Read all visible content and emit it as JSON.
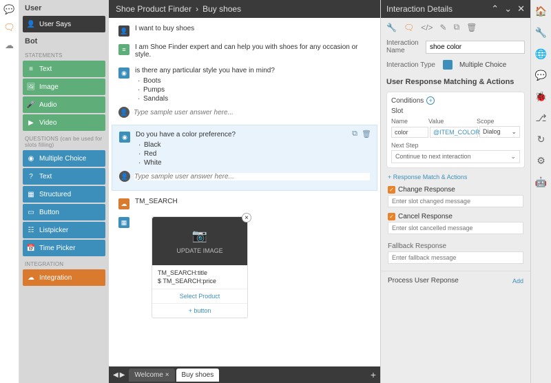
{
  "breadcrumb": {
    "project": "Shoe Product Finder",
    "flow": "Buy shoes"
  },
  "palette": {
    "user_header": "User",
    "user_says": "User Says",
    "bot_header": "Bot",
    "statements_label": "STATEMENTS",
    "statements": [
      {
        "label": "Text"
      },
      {
        "label": "Image"
      },
      {
        "label": "Audio"
      },
      {
        "label": "Video"
      }
    ],
    "questions_label": "QUESTIONS (can be used for slots filling)",
    "questions": [
      {
        "label": "Multiple Choice"
      },
      {
        "label": "Text"
      },
      {
        "label": "Structured"
      },
      {
        "label": "Button"
      },
      {
        "label": "Listpicker"
      },
      {
        "label": "Time Picker"
      }
    ],
    "integration_label": "INTEGRATION",
    "integration": {
      "label": "Integration"
    }
  },
  "flow": {
    "user_msg": "I want to buy shoes",
    "bot_msg": "I am Shoe Finder expert and can help you with shoes for any occasion or style.",
    "q1": {
      "text": "is there any particular style you have in mind?",
      "opts": [
        "Boots",
        "Pumps",
        "Sandals"
      ]
    },
    "q2": {
      "text": "Do you have a color preference?",
      "opts": [
        "Black",
        "Red",
        "White"
      ]
    },
    "sample_placeholder": "Type sample user answer here...",
    "search_label": "TM_SEARCH",
    "card": {
      "update_image": "UPDATE IMAGE",
      "title": "TM_SEARCH:title",
      "price": "$ TM_SEARCH:price",
      "select": "Select Product",
      "add_button": "+ button"
    }
  },
  "tabs": {
    "t1": "Welcome",
    "t2": "Buy shoes"
  },
  "details": {
    "title": "Interaction Details",
    "name_label": "Interaction Name",
    "name_value": "shoe color",
    "type_label": "Interaction Type",
    "type_value": "Multiple Choice",
    "matching_header": "User Response Matching & Actions",
    "conditions": "Conditions",
    "slot": "Slot",
    "col_name": "Name",
    "col_value": "Value",
    "col_scope": "Scope",
    "slot_name": "color",
    "slot_value": "@ITEM_COLOR",
    "slot_scope": "Dialog",
    "next_step": "Next Step",
    "next_step_value": "Continue to next interaction",
    "add_match": "+ Response Match & Actions",
    "change_resp": "Change Response",
    "change_ph": "Enter slot changed message",
    "cancel_resp": "Cancel Response",
    "cancel_ph": "Enter slot cancelled message",
    "fallback": "Fallback Response",
    "fallback_ph": "Enter fallback message",
    "process": "Process User Reponse",
    "add": "Add"
  }
}
